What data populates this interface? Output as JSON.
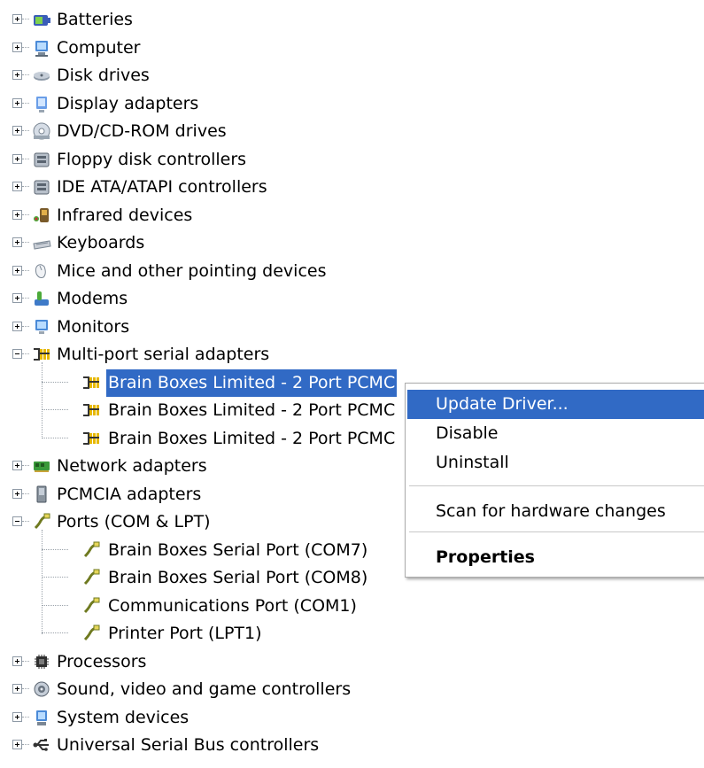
{
  "tree": {
    "items": [
      {
        "label": "Batteries",
        "icon": "battery-icon",
        "expanded": false
      },
      {
        "label": "Computer",
        "icon": "computer-icon",
        "expanded": false
      },
      {
        "label": "Disk drives",
        "icon": "disk-drive-icon",
        "expanded": false
      },
      {
        "label": "Display adapters",
        "icon": "display-adapter-icon",
        "expanded": false
      },
      {
        "label": "DVD/CD-ROM drives",
        "icon": "dvd-drive-icon",
        "expanded": false
      },
      {
        "label": "Floppy disk controllers",
        "icon": "floppy-controller-icon",
        "expanded": false
      },
      {
        "label": "IDE ATA/ATAPI controllers",
        "icon": "ide-controller-icon",
        "expanded": false
      },
      {
        "label": "Infrared devices",
        "icon": "infrared-icon",
        "expanded": false
      },
      {
        "label": "Keyboards",
        "icon": "keyboard-icon",
        "expanded": false
      },
      {
        "label": "Mice and other pointing devices",
        "icon": "mouse-icon",
        "expanded": false
      },
      {
        "label": "Modems",
        "icon": "modem-icon",
        "expanded": false
      },
      {
        "label": "Monitors",
        "icon": "monitor-icon",
        "expanded": false
      },
      {
        "label": "Multi-port serial adapters",
        "icon": "serial-adapter-icon",
        "expanded": true,
        "children": [
          {
            "label": "Brain Boxes Limited - 2 Port PCMC",
            "icon": "serial-adapter-icon",
            "selected": true
          },
          {
            "label": "Brain Boxes Limited - 2 Port PCMC",
            "icon": "serial-adapter-icon",
            "selected": false
          },
          {
            "label": "Brain Boxes Limited - 2 Port PCMC",
            "icon": "serial-adapter-icon",
            "selected": false
          }
        ]
      },
      {
        "label": "Network adapters",
        "icon": "network-adapter-icon",
        "expanded": false
      },
      {
        "label": "PCMCIA adapters",
        "icon": "pcmcia-icon",
        "expanded": false
      },
      {
        "label": "Ports (COM & LPT)",
        "icon": "port-icon",
        "expanded": true,
        "children": [
          {
            "label": "Brain Boxes Serial Port (COM7)",
            "icon": "port-icon",
            "selected": false
          },
          {
            "label": "Brain Boxes Serial Port (COM8)",
            "icon": "port-icon",
            "selected": false
          },
          {
            "label": "Communications Port (COM1)",
            "icon": "port-icon",
            "selected": false
          },
          {
            "label": "Printer Port (LPT1)",
            "icon": "port-icon",
            "selected": false
          }
        ]
      },
      {
        "label": "Processors",
        "icon": "processor-icon",
        "expanded": false
      },
      {
        "label": "Sound, video and game controllers",
        "icon": "sound-icon",
        "expanded": false
      },
      {
        "label": "System devices",
        "icon": "system-device-icon",
        "expanded": false
      },
      {
        "label": "Universal Serial Bus controllers",
        "icon": "usb-icon",
        "expanded": false
      }
    ]
  },
  "context_menu": {
    "update_driver": "Update Driver...",
    "disable": "Disable",
    "uninstall": "Uninstall",
    "scan": "Scan for hardware changes",
    "properties": "Properties"
  },
  "colors": {
    "selection": "#316ac5",
    "selection_text": "#ffffff"
  }
}
